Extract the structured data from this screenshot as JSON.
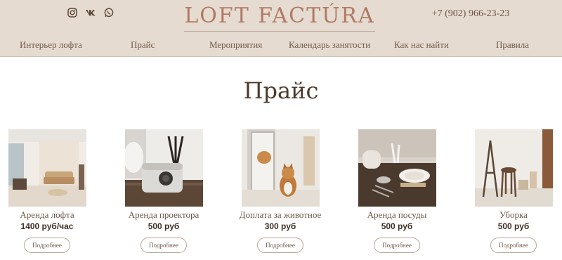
{
  "header": {
    "logo": "LOFT FACTÚRA",
    "phone": "+7 (902) 966-23-23",
    "social_icons": [
      "instagram-icon",
      "vk-icon",
      "whatsapp-icon"
    ]
  },
  "nav": {
    "items": [
      {
        "label": "Интерьер лофта"
      },
      {
        "label": "Прайс"
      },
      {
        "label": "Мероприятия"
      },
      {
        "label": "Календарь занятости"
      },
      {
        "label": "Как нас найти"
      },
      {
        "label": "Правила"
      }
    ]
  },
  "page": {
    "title": "Прайс"
  },
  "cards": [
    {
      "name": "Аренда лофта",
      "price": "1400 руб/час",
      "button": "Подробнее"
    },
    {
      "name": "Аренда проектора",
      "price": "500 руб",
      "button": "Подробнее"
    },
    {
      "name": "Доплата за животное",
      "price": "300 руб",
      "button": "Подробнее"
    },
    {
      "name": "Аренда посуды",
      "price": "500 руб",
      "button": "Подробнее"
    },
    {
      "name": "Уборка",
      "price": "500 руб",
      "button": "Подробнее"
    }
  ],
  "colors": {
    "header_bg": "#e6dbd0",
    "logo": "#b07965",
    "text": "#6f5846"
  }
}
